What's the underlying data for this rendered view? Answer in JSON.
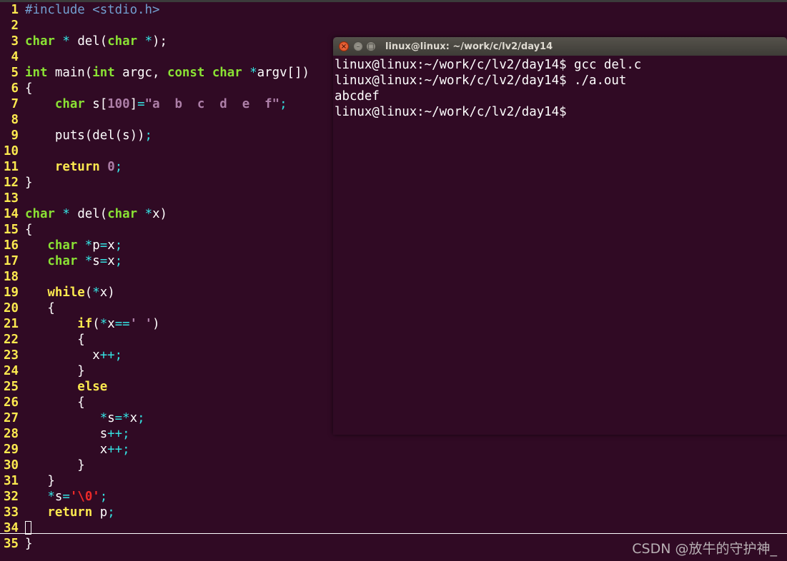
{
  "editor": {
    "lines": [
      {
        "n": "1",
        "tokens": [
          [
            "pre",
            "#include "
          ],
          [
            "pre",
            "<stdio.h>"
          ]
        ]
      },
      {
        "n": "2",
        "tokens": []
      },
      {
        "n": "3",
        "tokens": [
          [
            "type",
            "char"
          ],
          [
            "op",
            " * "
          ],
          [
            "plain",
            "del("
          ],
          [
            "type",
            "char"
          ],
          [
            "op",
            " *"
          ],
          [
            "plain",
            ");"
          ]
        ]
      },
      {
        "n": "4",
        "tokens": []
      },
      {
        "n": "5",
        "tokens": [
          [
            "type",
            "int"
          ],
          [
            "plain",
            " main("
          ],
          [
            "type",
            "int"
          ],
          [
            "plain",
            " argc, "
          ],
          [
            "type",
            "const"
          ],
          [
            "plain",
            " "
          ],
          [
            "type",
            "char"
          ],
          [
            "plain",
            " "
          ],
          [
            "op",
            "*"
          ],
          [
            "plain",
            "argv[])"
          ]
        ]
      },
      {
        "n": "6",
        "tokens": [
          [
            "plain",
            "{"
          ]
        ]
      },
      {
        "n": "7",
        "tokens": [
          [
            "plain",
            "    "
          ],
          [
            "type",
            "char"
          ],
          [
            "plain",
            " s["
          ],
          [
            "num",
            "100"
          ],
          [
            "plain",
            "]"
          ],
          [
            "op",
            "="
          ],
          [
            "str",
            "\"a  b  c  d  e  f\""
          ],
          [
            "op",
            ";"
          ]
        ]
      },
      {
        "n": "8",
        "tokens": []
      },
      {
        "n": "9",
        "tokens": [
          [
            "plain",
            "    puts(del(s))"
          ],
          [
            "op",
            ";"
          ]
        ]
      },
      {
        "n": "10",
        "tokens": []
      },
      {
        "n": "11",
        "tokens": [
          [
            "plain",
            "    "
          ],
          [
            "kw",
            "return"
          ],
          [
            "plain",
            " "
          ],
          [
            "num",
            "0"
          ],
          [
            "op",
            ";"
          ]
        ]
      },
      {
        "n": "12",
        "tokens": [
          [
            "plain",
            "}"
          ]
        ]
      },
      {
        "n": "13",
        "tokens": []
      },
      {
        "n": "14",
        "tokens": [
          [
            "type",
            "char"
          ],
          [
            "op",
            " * "
          ],
          [
            "plain",
            "del("
          ],
          [
            "type",
            "char"
          ],
          [
            "plain",
            " "
          ],
          [
            "op",
            "*"
          ],
          [
            "plain",
            "x)"
          ]
        ]
      },
      {
        "n": "15",
        "tokens": [
          [
            "plain",
            "{"
          ]
        ]
      },
      {
        "n": "16",
        "tokens": [
          [
            "plain",
            "   "
          ],
          [
            "type",
            "char"
          ],
          [
            "plain",
            " "
          ],
          [
            "op",
            "*"
          ],
          [
            "plain",
            "p"
          ],
          [
            "op",
            "="
          ],
          [
            "plain",
            "x"
          ],
          [
            "op",
            ";"
          ]
        ]
      },
      {
        "n": "17",
        "tokens": [
          [
            "plain",
            "   "
          ],
          [
            "type",
            "char"
          ],
          [
            "plain",
            " "
          ],
          [
            "op",
            "*"
          ],
          [
            "plain",
            "s"
          ],
          [
            "op",
            "="
          ],
          [
            "plain",
            "x"
          ],
          [
            "op",
            ";"
          ]
        ]
      },
      {
        "n": "18",
        "tokens": []
      },
      {
        "n": "19",
        "tokens": [
          [
            "plain",
            "   "
          ],
          [
            "kw",
            "while"
          ],
          [
            "plain",
            "("
          ],
          [
            "op",
            "*"
          ],
          [
            "plain",
            "x)"
          ]
        ]
      },
      {
        "n": "20",
        "tokens": [
          [
            "plain",
            "   {"
          ]
        ]
      },
      {
        "n": "21",
        "tokens": [
          [
            "plain",
            "       "
          ],
          [
            "kw",
            "if"
          ],
          [
            "plain",
            "("
          ],
          [
            "op",
            "*"
          ],
          [
            "plain",
            "x"
          ],
          [
            "op",
            "=="
          ],
          [
            "char",
            "' '"
          ],
          [
            "plain",
            ")"
          ]
        ]
      },
      {
        "n": "22",
        "tokens": [
          [
            "plain",
            "       {"
          ]
        ]
      },
      {
        "n": "23",
        "tokens": [
          [
            "plain",
            "         x"
          ],
          [
            "op",
            "++;"
          ]
        ]
      },
      {
        "n": "24",
        "tokens": [
          [
            "plain",
            "       }"
          ]
        ]
      },
      {
        "n": "25",
        "tokens": [
          [
            "plain",
            "       "
          ],
          [
            "kw",
            "else"
          ]
        ]
      },
      {
        "n": "26",
        "tokens": [
          [
            "plain",
            "       {"
          ]
        ]
      },
      {
        "n": "27",
        "tokens": [
          [
            "plain",
            "          "
          ],
          [
            "op",
            "*"
          ],
          [
            "plain",
            "s"
          ],
          [
            "op",
            "=*"
          ],
          [
            "plain",
            "x"
          ],
          [
            "op",
            ";"
          ]
        ]
      },
      {
        "n": "28",
        "tokens": [
          [
            "plain",
            "          s"
          ],
          [
            "op",
            "++;"
          ]
        ]
      },
      {
        "n": "29",
        "tokens": [
          [
            "plain",
            "          x"
          ],
          [
            "op",
            "++;"
          ]
        ]
      },
      {
        "n": "30",
        "tokens": [
          [
            "plain",
            "       }"
          ]
        ]
      },
      {
        "n": "31",
        "tokens": [
          [
            "plain",
            "   }"
          ]
        ]
      },
      {
        "n": "32",
        "tokens": [
          [
            "plain",
            "   "
          ],
          [
            "op",
            "*"
          ],
          [
            "plain",
            "s"
          ],
          [
            "op",
            "="
          ],
          [
            "esc",
            "'\\0'"
          ],
          [
            "op",
            ";"
          ]
        ]
      },
      {
        "n": "33",
        "tokens": [
          [
            "plain",
            "   "
          ],
          [
            "kw",
            "return"
          ],
          [
            "plain",
            " p"
          ],
          [
            "op",
            ";"
          ]
        ]
      },
      {
        "n": "34",
        "tokens": [],
        "cursor": true
      },
      {
        "n": "35",
        "tokens": [
          [
            "plain",
            "}"
          ]
        ]
      }
    ]
  },
  "terminal": {
    "title": "linux@linux: ~/work/c/lv2/day14",
    "close_glyph": "×",
    "minimize_glyph": "–",
    "maximize_glyph": "□",
    "lines": [
      "linux@linux:~/work/c/lv2/day14$ gcc del.c",
      "linux@linux:~/work/c/lv2/day14$ ./a.out",
      "abcdef",
      "linux@linux:~/work/c/lv2/day14$"
    ]
  },
  "watermark": "CSDN @放牛的守护神_"
}
